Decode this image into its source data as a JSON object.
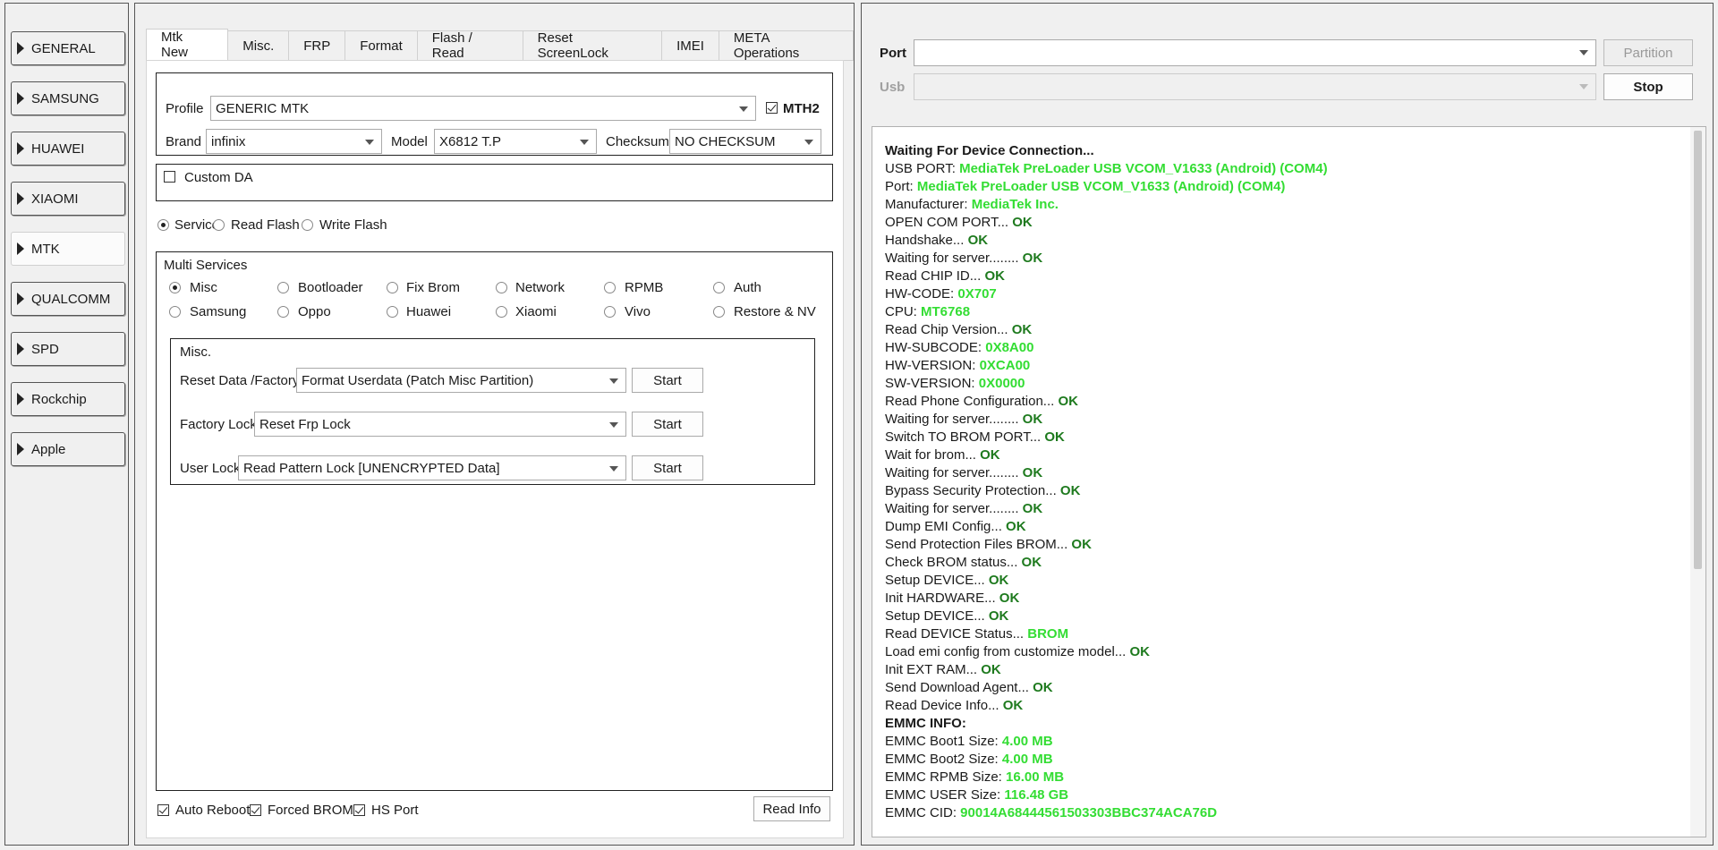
{
  "sidebar": {
    "items": [
      {
        "label": "GENERAL"
      },
      {
        "label": "SAMSUNG"
      },
      {
        "label": "HUAWEI"
      },
      {
        "label": "XIAOMI"
      },
      {
        "label": "MTK"
      },
      {
        "label": "QUALCOMM"
      },
      {
        "label": "SPD"
      },
      {
        "label": "Rockchip"
      },
      {
        "label": "Apple"
      }
    ],
    "active": "MTK"
  },
  "tabs": [
    "Mtk New",
    "Misc.",
    "FRP",
    "Format",
    "Flash / Read",
    "Reset ScreenLock",
    "IMEI",
    "META Operations"
  ],
  "active_tab": "Mtk New",
  "profile": {
    "profile_label": "Profile",
    "profile_value": "GENERIC MTK",
    "mth2_label": "MTH2",
    "mth2_checked": true,
    "brand_label": "Brand",
    "brand_value": "infinix",
    "model_label": "Model",
    "model_value": "X6812 T.P",
    "checksum_label": "Checksum",
    "checksum_value": "NO CHECKSUM"
  },
  "custom_da": {
    "label": "Custom DA",
    "checked": false
  },
  "mode": {
    "options": [
      "Service",
      "Read Flash",
      "Write Flash"
    ],
    "selected": "Service"
  },
  "multi_services": {
    "title": "Multi Services",
    "row1": [
      "Misc",
      "Bootloader",
      "Fix Brom",
      "Network",
      "RPMB",
      "Auth"
    ],
    "row2": [
      "Samsung",
      "Oppo",
      "Huawei",
      "Xiaomi",
      "Vivo",
      "Restore & NV"
    ],
    "selected": "Misc"
  },
  "misc": {
    "title": "Misc.",
    "reset_label": "Reset Data /Factory",
    "reset_value": "Format Userdata (Patch Misc Partition)",
    "factory_label": "Factory Lock",
    "factory_value": "Reset Frp Lock",
    "user_label": "User Lock",
    "user_value": "Read Pattern Lock [UNENCRYPTED Data]",
    "start_label": "Start"
  },
  "bottom": {
    "auto_reboot": "Auto Reboot",
    "forced_brom": "Forced BROM",
    "hs_port": "HS Port",
    "read_info": "Read Info"
  },
  "port": {
    "port_label": "Port",
    "port_value": "",
    "usb_label": "Usb",
    "usb_value": "",
    "partition_label": "Partition",
    "stop_label": "Stop"
  },
  "colors": {
    "ok": "#1e7a1e",
    "info": "#33dd33"
  },
  "log": [
    {
      "k": "Waiting For Device Connection...",
      "v": "",
      "c": "",
      "bold": true
    },
    {
      "k": "USB PORT: ",
      "v": "MediaTek PreLoader USB VCOM_V1633 (Android) (COM4)",
      "c": "info"
    },
    {
      "k": "Port: ",
      "v": "MediaTek PreLoader USB VCOM_V1633 (Android) (COM4)",
      "c": "info"
    },
    {
      "k": "Manufacturer: ",
      "v": "MediaTek Inc.",
      "c": "info"
    },
    {
      "k": "OPEN COM PORT... ",
      "v": "OK",
      "c": "ok"
    },
    {
      "k": "Handshake... ",
      "v": "OK",
      "c": "ok"
    },
    {
      "k": "Waiting for server........ ",
      "v": "OK",
      "c": "ok"
    },
    {
      "k": "Read CHIP ID... ",
      "v": "OK",
      "c": "ok"
    },
    {
      "k": "HW-CODE: ",
      "v": "0X707",
      "c": "info"
    },
    {
      "k": "CPU: ",
      "v": "MT6768",
      "c": "info"
    },
    {
      "k": "Read Chip Version... ",
      "v": "OK",
      "c": "ok"
    },
    {
      "k": "HW-SUBCODE: ",
      "v": "0X8A00",
      "c": "info"
    },
    {
      "k": "HW-VERSION: ",
      "v": "0XCA00",
      "c": "info"
    },
    {
      "k": "SW-VERSION: ",
      "v": "0X0000",
      "c": "info"
    },
    {
      "k": "Read Phone Configuration... ",
      "v": "OK",
      "c": "ok"
    },
    {
      "k": "Waiting for server........ ",
      "v": "OK",
      "c": "ok"
    },
    {
      "k": "Switch TO BROM PORT... ",
      "v": "OK",
      "c": "ok"
    },
    {
      "k": "Wait for brom... ",
      "v": "OK",
      "c": "ok"
    },
    {
      "k": "Waiting for server........ ",
      "v": "OK",
      "c": "ok"
    },
    {
      "k": "Bypass Security Protection... ",
      "v": "OK",
      "c": "ok"
    },
    {
      "k": "Waiting for server........ ",
      "v": "OK",
      "c": "ok"
    },
    {
      "k": "Dump EMI Config... ",
      "v": "OK",
      "c": "ok"
    },
    {
      "k": "Send Protection Files BROM... ",
      "v": "OK",
      "c": "ok"
    },
    {
      "k": "Check BROM status... ",
      "v": "OK",
      "c": "ok"
    },
    {
      "k": "Setup DEVICE... ",
      "v": "OK",
      "c": "ok"
    },
    {
      "k": "Init HARDWARE... ",
      "v": "OK",
      "c": "ok"
    },
    {
      "k": "Setup DEVICE... ",
      "v": "OK",
      "c": "ok"
    },
    {
      "k": "Read DEVICE Status... ",
      "v": "BROM",
      "c": "info"
    },
    {
      "k": "Load emi config from customize model... ",
      "v": "OK",
      "c": "ok"
    },
    {
      "k": "Init EXT RAM... ",
      "v": "OK",
      "c": "ok"
    },
    {
      "k": "Send Download Agent... ",
      "v": "OK",
      "c": "ok"
    },
    {
      "k": "Read Device Info... ",
      "v": "OK",
      "c": "ok"
    },
    {
      "k": "EMMC INFO:",
      "v": "",
      "c": "",
      "bold": true
    },
    {
      "k": "EMMC Boot1 Size: ",
      "v": "4.00 MB",
      "c": "info"
    },
    {
      "k": "EMMC Boot2 Size: ",
      "v": "4.00 MB",
      "c": "info"
    },
    {
      "k": "EMMC RPMB Size: ",
      "v": "16.00 MB",
      "c": "info"
    },
    {
      "k": "EMMC USER Size: ",
      "v": "116.48 GB",
      "c": "info"
    },
    {
      "k": "EMMC CID: ",
      "v": "90014A68444561503303BBC374ACA76D",
      "c": "info"
    }
  ]
}
